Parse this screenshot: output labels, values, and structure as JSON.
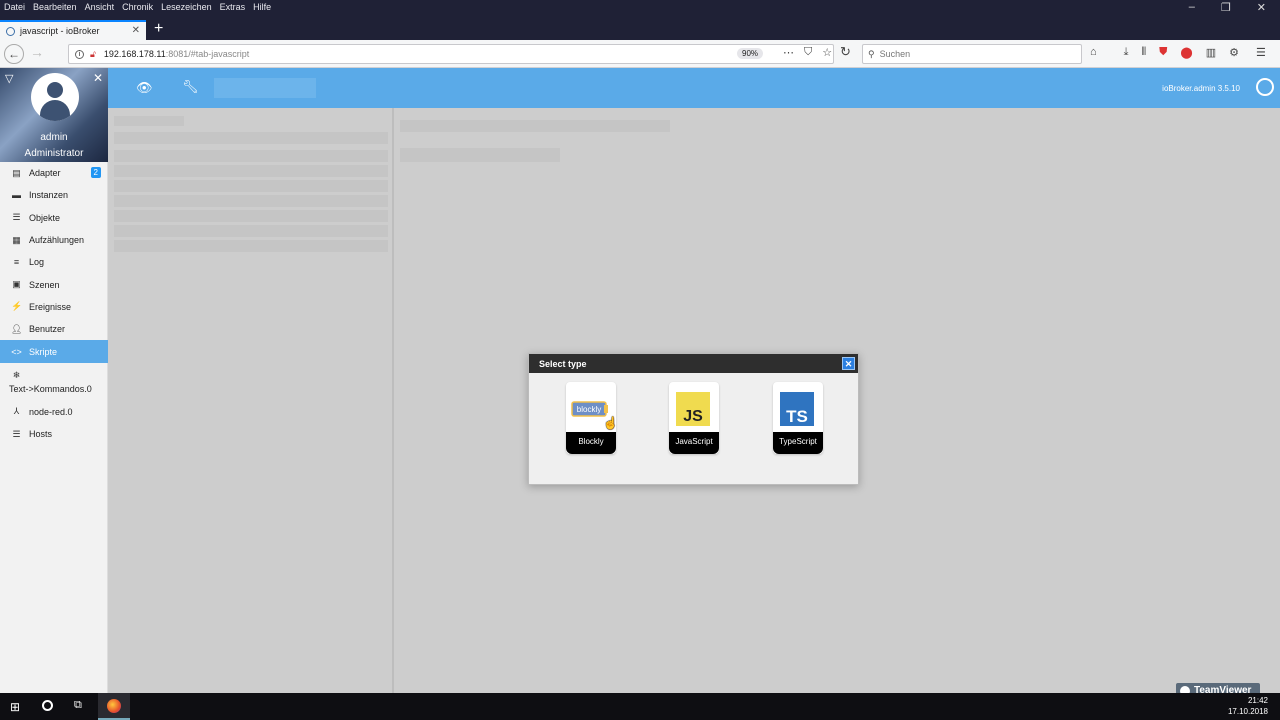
{
  "browser": {
    "menu": [
      "Datei",
      "Bearbeiten",
      "Ansicht",
      "Chronik",
      "Lesezeichen",
      "Extras",
      "Hilfe"
    ],
    "tab_title": "javascript - ioBroker",
    "url_host": "192.168.178.11",
    "url_rest": ":8081/#tab-javascript",
    "zoom": "90%",
    "search_placeholder": "Suchen"
  },
  "app": {
    "user_name": "admin",
    "user_role": "Administrator",
    "version": "ioBroker.admin 3.5.10",
    "nav": [
      {
        "label": "Adapter",
        "badge": "2",
        "icon": "adapter-icon"
      },
      {
        "label": "Instanzen",
        "icon": "instances-icon"
      },
      {
        "label": "Objekte",
        "icon": "objects-icon"
      },
      {
        "label": "Aufzählungen",
        "icon": "enums-icon"
      },
      {
        "label": "Log",
        "icon": "log-icon"
      },
      {
        "label": "Szenen",
        "icon": "scenes-icon"
      },
      {
        "label": "Ereignisse",
        "icon": "events-icon"
      },
      {
        "label": "Benutzer",
        "icon": "users-icon"
      },
      {
        "label": "Skripte",
        "icon": "code-icon",
        "active": true
      },
      {
        "label": "Text->Kommandos.0",
        "icon": "snowflake-icon"
      },
      {
        "label": "node-red.0",
        "icon": "node-red-icon"
      },
      {
        "label": "Hosts",
        "icon": "hosts-icon"
      }
    ]
  },
  "dialog": {
    "title": "Select type",
    "options": [
      {
        "label": "Blockly",
        "logo_text": "blockly"
      },
      {
        "label": "JavaScript",
        "logo_text": "JS"
      },
      {
        "label": "TypeScript",
        "logo_text": "TS"
      }
    ]
  },
  "taskbar": {
    "time": "21:42",
    "date": "17.10.2018",
    "teamviewer": "TeamViewer"
  },
  "colors": {
    "accent": "#5aaae8",
    "js_yellow": "#f0db4f",
    "ts_blue": "#2f74c0"
  }
}
